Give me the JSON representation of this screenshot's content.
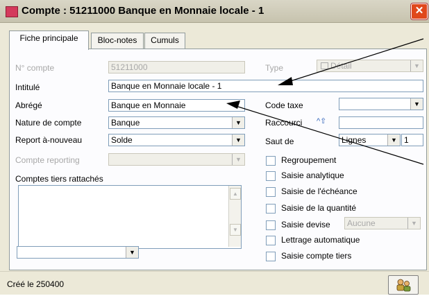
{
  "window": {
    "title": "Compte : 51211000 Banque en Monnaie locale - 1",
    "close_glyph": "✕"
  },
  "tabs": [
    {
      "label": "Fiche principale"
    },
    {
      "label": "Bloc-notes"
    },
    {
      "label": "Cumuls"
    }
  ],
  "form": {
    "numero_label": "N° compte",
    "numero_value": "51211000",
    "type_label": "Type",
    "type_value": "Détail",
    "intitule_label": "Intitulé",
    "intitule_value": "Banque en Monnaie locale - 1",
    "abrege_label": "Abrégé",
    "abrege_value": "Banque en Monnaie",
    "nature_label": "Nature de compte",
    "nature_value": "Banque",
    "report_label": "Report à-nouveau",
    "report_value": "Solde",
    "reporting_label": "Compte reporting",
    "reporting_value": "",
    "tiers_label": "Comptes tiers rattachés",
    "code_taxe_label": "Code taxe",
    "code_taxe_value": "",
    "raccourci_label": "Raccourci",
    "raccourci_glyph": "^⇧",
    "raccourci_value": "",
    "saut_label": "Saut de",
    "saut_value": "Lignes",
    "saut_number": "1",
    "saisie_devise_value": "Aucune",
    "checkboxes": [
      {
        "label": "Regroupement",
        "checked": false
      },
      {
        "label": "Saisie analytique",
        "checked": false
      },
      {
        "label": "Saisie de l'échéance",
        "checked": false
      },
      {
        "label": "Saisie de la quantité",
        "checked": false
      },
      {
        "label": "Saisie devise",
        "checked": false
      },
      {
        "label": "Lettrage automatique",
        "checked": false
      },
      {
        "label": "Saisie compte tiers",
        "checked": false
      }
    ]
  },
  "status": {
    "created": "Créé le 250400"
  },
  "icons": {
    "dropdown": "▼",
    "scroll_up": "▲",
    "scroll_down": "▼"
  },
  "colors": {
    "accent": "#d43a5c",
    "close": "#e0481c",
    "window_bg": "#ece9d8"
  }
}
